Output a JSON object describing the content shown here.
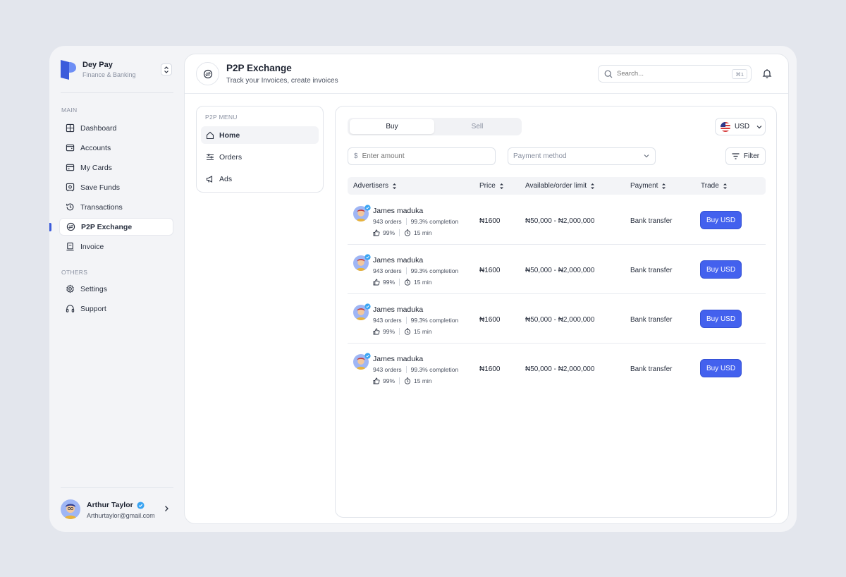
{
  "brand": {
    "name": "Dey Pay",
    "subtitle": "Finance & Banking"
  },
  "sidebar": {
    "main_label": "MAIN",
    "items": [
      {
        "label": "Dashboard",
        "icon": "dashboard-icon"
      },
      {
        "label": "Accounts",
        "icon": "wallet-icon"
      },
      {
        "label": "My Cards",
        "icon": "card-icon"
      },
      {
        "label": "Save Funds",
        "icon": "save-funds-icon"
      },
      {
        "label": "Transactions",
        "icon": "history-icon"
      },
      {
        "label": "P2P Exchange",
        "icon": "exchange-icon",
        "active": true
      },
      {
        "label": "Invoice",
        "icon": "invoice-icon"
      }
    ],
    "others_label": "OTHERS",
    "others": [
      {
        "label": "Settings",
        "icon": "settings-icon"
      },
      {
        "label": "Support",
        "icon": "headset-icon"
      }
    ]
  },
  "user": {
    "name": "Arthur Taylor",
    "email": "Arthurtaylor@gmail.com"
  },
  "header": {
    "title": "P2P Exchange",
    "subtitle": "Track your Invoices, create invoices",
    "search_placeholder": "Search...",
    "search_shortcut": "⌘1"
  },
  "p2p_menu": {
    "label": "P2P MENU",
    "items": [
      {
        "label": "Home",
        "icon": "home-icon",
        "active": true
      },
      {
        "label": "Orders",
        "icon": "orders-icon"
      },
      {
        "label": "Ads",
        "icon": "megaphone-icon"
      }
    ]
  },
  "trade": {
    "tabs": {
      "buy": "Buy",
      "sell": "Sell"
    },
    "currency": "USD",
    "amount_symbol": "$",
    "amount_placeholder": "Enter amount",
    "payment_method_placeholder": "Payment method",
    "filter_label": "Filter"
  },
  "table": {
    "headers": {
      "advertisers": "Advertisers",
      "price": "Price",
      "limit": "Available/order limit",
      "payment": "Payment",
      "trade": "Trade"
    },
    "rows": [
      {
        "name": "James maduka",
        "orders": "943 orders",
        "completion": "99.3% completion",
        "likes": "99%",
        "time": "15 min",
        "price": "₦1600",
        "limit": "₦50,000 - ₦2,000,000",
        "payment": "Bank transfer",
        "action": "Buy USD"
      },
      {
        "name": "James maduka",
        "orders": "943 orders",
        "completion": "99.3% completion",
        "likes": "99%",
        "time": "15 min",
        "price": "₦1600",
        "limit": "₦50,000 - ₦2,000,000",
        "payment": "Bank transfer",
        "action": "Buy USD"
      },
      {
        "name": "James maduka",
        "orders": "943 orders",
        "completion": "99.3% completion",
        "likes": "99%",
        "time": "15 min",
        "price": "₦1600",
        "limit": "₦50,000 - ₦2,000,000",
        "payment": "Bank transfer",
        "action": "Buy USD"
      },
      {
        "name": "James maduka",
        "orders": "943 orders",
        "completion": "99.3% completion",
        "likes": "99%",
        "time": "15 min",
        "price": "₦1600",
        "limit": "₦50,000 - ₦2,000,000",
        "payment": "Bank transfer",
        "action": "Buy USD"
      }
    ]
  },
  "colors": {
    "accent": "#4361ee",
    "verified": "#3aa4f2",
    "background": "#e3e6ed"
  }
}
